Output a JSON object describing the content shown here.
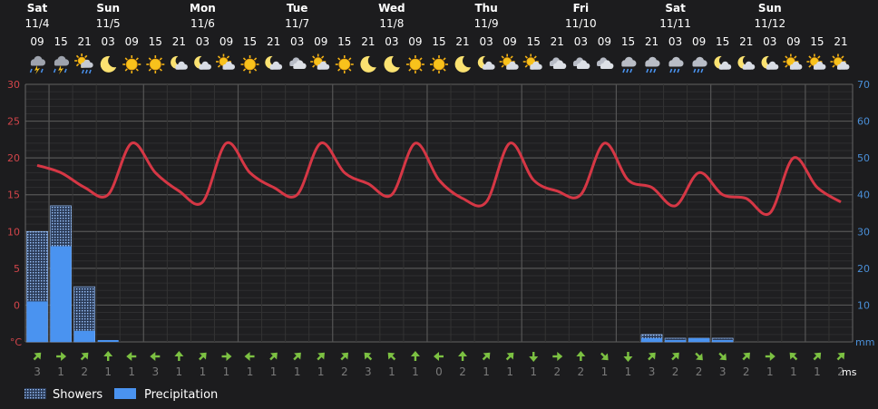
{
  "colors": {
    "background": "#1c1c1e",
    "temperature_line": "#d63745",
    "precipitation": "#4a93f0",
    "showers": "#9bc4ff",
    "wind_arrow": "#7cc142",
    "left_axis": "#d2454a",
    "right_axis": "#4a8fd8"
  },
  "header": {
    "days": [
      {
        "name": "Sat",
        "date": "11/4"
      },
      {
        "name": "Sun",
        "date": "11/5"
      },
      {
        "name": "Mon",
        "date": "11/6"
      },
      {
        "name": "Tue",
        "date": "11/7"
      },
      {
        "name": "Wed",
        "date": "11/8"
      },
      {
        "name": "Thu",
        "date": "11/9"
      },
      {
        "name": "Fri",
        "date": "11/10"
      },
      {
        "name": "Sat",
        "date": "11/11"
      },
      {
        "name": "Sun",
        "date": "11/12"
      }
    ],
    "hours": [
      "09",
      "15",
      "21",
      "03",
      "09",
      "15",
      "21",
      "03",
      "09",
      "15",
      "21",
      "03",
      "09",
      "15",
      "21",
      "03",
      "09",
      "15",
      "21",
      "03",
      "09",
      "15",
      "21",
      "03",
      "09",
      "15",
      "21",
      "03",
      "09",
      "15",
      "21",
      "03",
      "09",
      "15",
      "21"
    ],
    "weather_icons": [
      "thunder-rain-icon",
      "thunder-rain-icon",
      "sun-cloud-rain-icon",
      "moon-icon",
      "sun-icon",
      "sun-icon",
      "moon-cloud-icon",
      "moon-cloud-icon",
      "sun-cloud-icon",
      "sun-icon",
      "moon-cloud-icon",
      "cloud-icon",
      "sun-cloud-icon",
      "sun-icon",
      "moon-icon",
      "moon-icon",
      "sun-icon",
      "sun-icon",
      "moon-icon",
      "moon-cloud-icon",
      "sun-cloud-icon",
      "sun-cloud-icon",
      "cloud-icon",
      "cloud-icon",
      "cloud-icon",
      "cloud-rain-icon",
      "cloud-rain-icon",
      "cloud-rain-icon",
      "cloud-rain-icon",
      "moon-cloud-icon",
      "moon-cloud-icon",
      "moon-cloud-icon",
      "sun-cloud-icon",
      "sun-cloud-icon",
      "sun-cloud-icon"
    ]
  },
  "chart_data": {
    "type": "line",
    "x": [
      "11/4 09",
      "11/4 15",
      "11/4 21",
      "11/5 03",
      "11/5 09",
      "11/5 15",
      "11/5 21",
      "11/6 03",
      "11/6 09",
      "11/6 15",
      "11/6 21",
      "11/7 03",
      "11/7 09",
      "11/7 15",
      "11/7 21",
      "11/8 03",
      "11/8 09",
      "11/8 15",
      "11/8 21",
      "11/9 03",
      "11/9 09",
      "11/9 15",
      "11/9 21",
      "11/10 03",
      "11/10 09",
      "11/10 15",
      "11/10 21",
      "11/11 03",
      "11/11 09",
      "11/11 15",
      "11/11 21",
      "11/12 03",
      "11/12 09",
      "11/12 15",
      "11/12 21"
    ],
    "left_axis": {
      "ticks": [
        30,
        25,
        20,
        15,
        10,
        5,
        0
      ],
      "bottom_label": "°C",
      "ylim": [
        -5,
        30
      ]
    },
    "right_axis": {
      "ticks": [
        70,
        60,
        50,
        40,
        30,
        20,
        10
      ],
      "unit": "mm",
      "ylim": [
        0,
        70
      ]
    },
    "series": [
      {
        "name": "Temperature",
        "axis": "left",
        "kind": "line",
        "values": [
          19,
          18,
          16,
          15,
          22,
          18,
          15.5,
          14,
          22,
          18,
          16,
          15,
          22,
          18,
          16.5,
          15,
          22,
          17,
          14.5,
          14,
          22,
          17,
          15.5,
          15,
          22,
          17,
          16,
          13.5,
          18,
          15,
          14.5,
          12.5,
          20,
          16,
          14
        ]
      },
      {
        "name": "Showers",
        "axis": "right",
        "kind": "bar",
        "values": [
          30,
          37,
          15,
          0,
          0,
          0,
          0,
          0,
          0,
          0,
          0,
          0,
          0,
          0,
          0,
          0,
          0,
          0,
          0,
          0,
          0,
          0,
          0,
          0,
          0,
          0,
          2,
          1,
          1,
          1,
          0,
          0,
          0,
          0,
          0
        ]
      },
      {
        "name": "Precipitation",
        "axis": "right",
        "kind": "bar",
        "values": [
          11,
          26,
          3,
          0.5,
          0,
          0,
          0,
          0,
          0,
          0,
          0,
          0,
          0,
          0,
          0,
          0,
          0,
          0,
          0,
          0,
          0,
          0,
          0,
          0,
          0,
          0,
          1,
          0.5,
          1,
          0.5,
          0,
          0,
          0,
          0,
          0
        ]
      }
    ],
    "wind": {
      "unit": "ms",
      "directions": [
        "NE",
        "E",
        "NE",
        "N",
        "W",
        "W",
        "N",
        "NE",
        "E",
        "W",
        "NE",
        "NE",
        "NE",
        "NE",
        "NW",
        "NW",
        "N",
        "W",
        "N",
        "NE",
        "NE",
        "S",
        "E",
        "N",
        "SE",
        "S",
        "NE",
        "NE",
        "SE",
        "SE",
        "NE",
        "E",
        "NW",
        "NE",
        "NE"
      ],
      "speeds": [
        "3",
        "1",
        "2",
        "1",
        "1",
        "3",
        "1",
        "1",
        "1",
        "1",
        "1",
        "1",
        "1",
        "2",
        "3",
        "1",
        "1",
        "0",
        "2",
        "1",
        "1",
        "1",
        "2",
        "2",
        "1",
        "1",
        "3",
        "2",
        "2",
        "3",
        "2",
        "1",
        "1",
        "1",
        "2"
      ]
    },
    "grid": true,
    "legend": {
      "position": "bottom-left",
      "items": [
        "Showers",
        "Precipitation"
      ]
    }
  }
}
